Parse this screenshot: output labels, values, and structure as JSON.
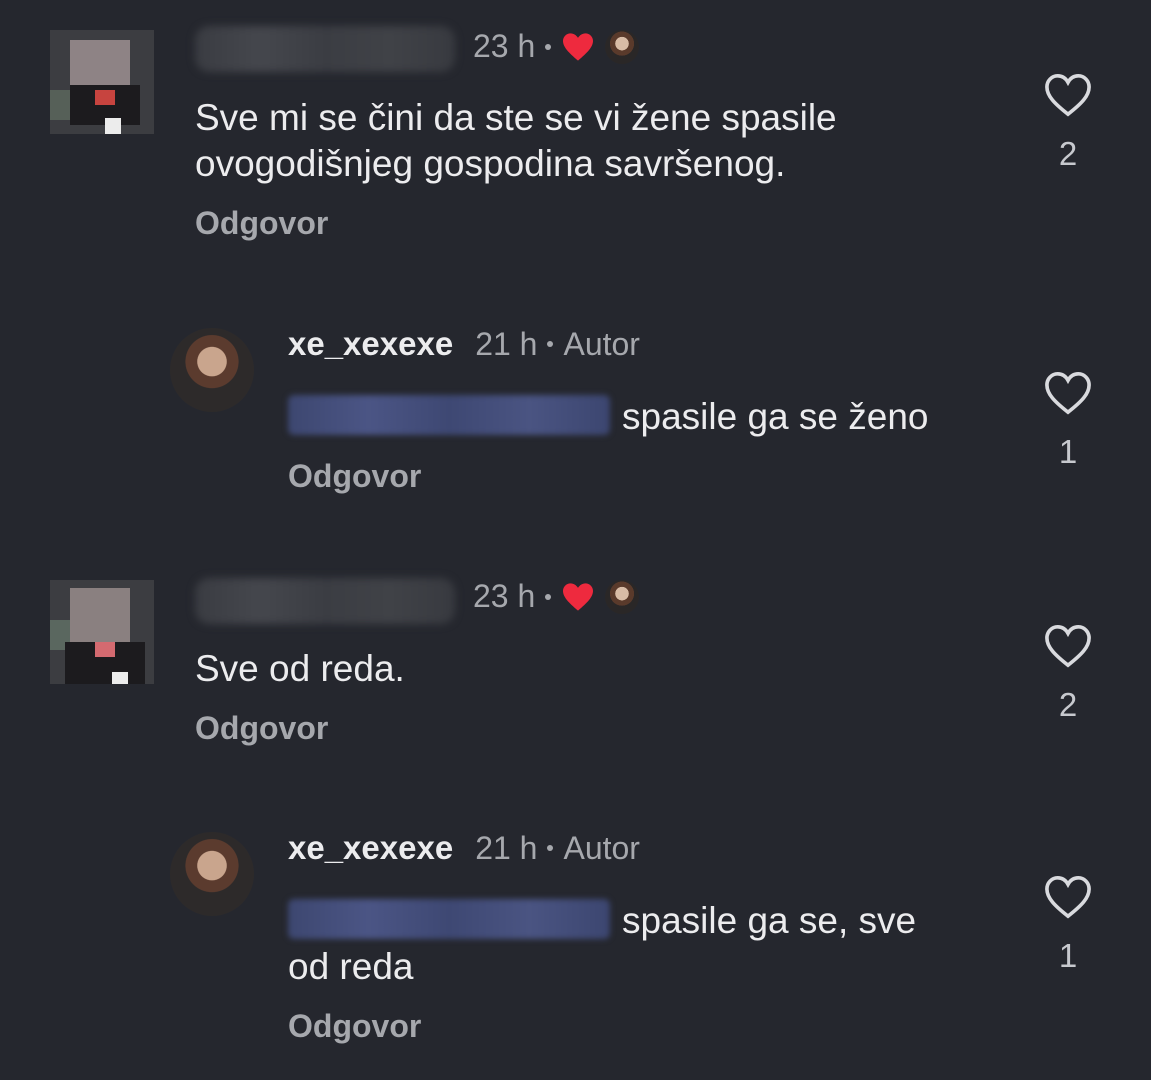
{
  "comments": [
    {
      "time": "23 h",
      "text": "Sve mi se čini da ste se vi žene spasile ovogodišnjeg gospodina savršenog.",
      "reply_label": "Odgovor",
      "likes": "2"
    },
    {
      "username": "xe_xexexe",
      "time": "21 h",
      "author_badge": "Autor",
      "text": "spasile ga se ženo",
      "reply_label": "Odgovor",
      "likes": "1"
    },
    {
      "time": "23 h",
      "text": "Sve od reda.",
      "reply_label": "Odgovor",
      "likes": "2"
    },
    {
      "username": "xe_xexexe",
      "time": "21 h",
      "author_badge": "Autor",
      "text_line1": "spasile ga se, sve",
      "text_line2": "od reda",
      "reply_label": "Odgovor",
      "likes": "1"
    }
  ],
  "colors": {
    "background": "#25272e",
    "heart_red": "#ee2a3e",
    "mention_blue": "#4b5585"
  },
  "icons": {
    "like": "heart-outline-icon",
    "creator_liked": "heart-filled-icon"
  }
}
